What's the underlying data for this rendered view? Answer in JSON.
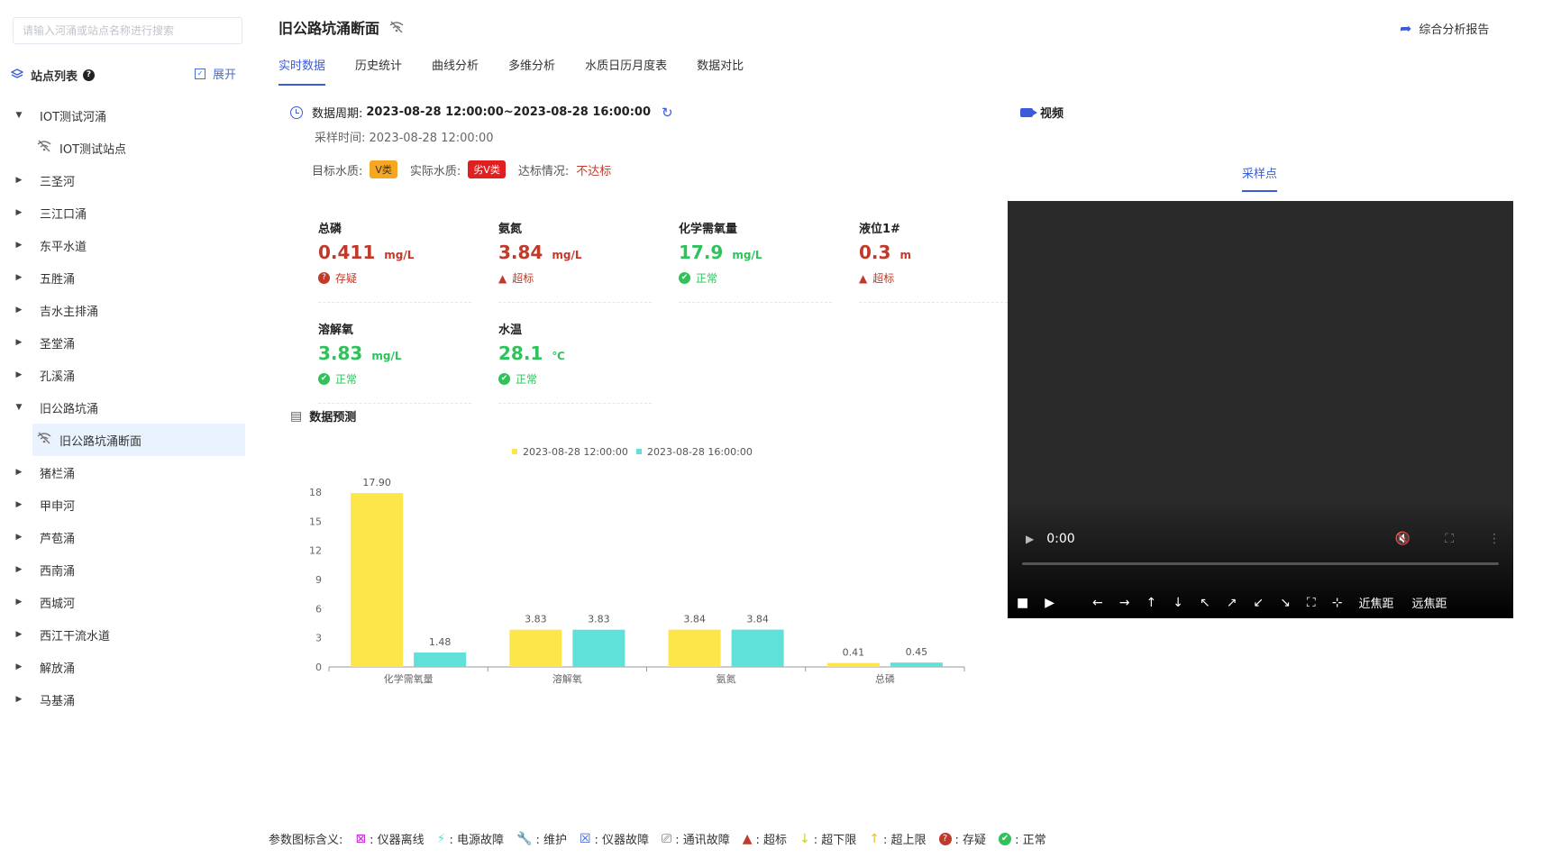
{
  "sidebar": {
    "search_placeholder": "请输入河涌或站点名称进行搜索",
    "title": "站点列表",
    "expand_label": "展开",
    "items": [
      {
        "label": "IOT测试河涌",
        "expanded": true,
        "children": [
          "IOT测试站点"
        ]
      },
      {
        "label": "三圣河"
      },
      {
        "label": "三江口涌"
      },
      {
        "label": "东平水道"
      },
      {
        "label": "五胜涌"
      },
      {
        "label": "吉水主排涌"
      },
      {
        "label": "圣堂涌"
      },
      {
        "label": "孔溪涌"
      },
      {
        "label": "旧公路坑涌",
        "expanded": true,
        "children": [
          "旧公路坑涌断面"
        ]
      },
      {
        "label": "猪栏涌"
      },
      {
        "label": "甲申河"
      },
      {
        "label": "芦苞涌"
      },
      {
        "label": "西南涌"
      },
      {
        "label": "西城河"
      },
      {
        "label": "西江干流水道"
      },
      {
        "label": "解放涌"
      },
      {
        "label": "马基涌"
      }
    ]
  },
  "header": {
    "title": "旧公路坑涌断面",
    "report_label": "综合分析报告",
    "tabs": [
      "实时数据",
      "历史统计",
      "曲线分析",
      "多维分析",
      "水质日历月度表",
      "数据对比"
    ]
  },
  "info": {
    "period_label": "数据周期:",
    "period_value": "2023-08-28 12:00:00~2023-08-28 16:00:00",
    "sample_time": "采样时间: 2023-08-28 12:00:00",
    "target_label": "目标水质:",
    "target_value": "V类",
    "actual_label": "实际水质:",
    "actual_value": "劣V类",
    "compliance_label": "达标情况:",
    "compliance_value": "不达标"
  },
  "metrics": [
    {
      "name": "总磷",
      "value": "0.411",
      "unit": "mg/L",
      "status": "存疑",
      "color": "red"
    },
    {
      "name": "氨氮",
      "value": "3.84",
      "unit": "mg/L",
      "status": "超标",
      "color": "red"
    },
    {
      "name": "化学需氧量",
      "value": "17.9",
      "unit": "mg/L",
      "status": "正常",
      "color": "green"
    },
    {
      "name": "液位1#",
      "value": "0.3",
      "unit": "m",
      "status": "超标",
      "color": "red"
    },
    {
      "name": "溶解氧",
      "value": "3.83",
      "unit": "mg/L",
      "status": "正常",
      "color": "green"
    },
    {
      "name": "水温",
      "value": "28.1",
      "unit": "℃",
      "status": "正常",
      "color": "green"
    }
  ],
  "predict": {
    "title": "数据预测"
  },
  "chart_data": {
    "type": "bar",
    "categories": [
      "化学需氧量",
      "溶解氧",
      "氨氮",
      "总磷"
    ],
    "series": [
      {
        "name": "2023-08-28 12:00:00",
        "values": [
          17.9,
          3.83,
          3.84,
          0.41
        ],
        "color": "#fce64a"
      },
      {
        "name": "2023-08-28 16:00:00",
        "values": [
          1.48,
          3.83,
          3.84,
          0.45
        ],
        "color": "#5fe0d8"
      }
    ],
    "data_labels": [
      [
        "17.90",
        "3.83",
        "3.84",
        "0.41"
      ],
      [
        "1.48",
        "3.83",
        "3.84",
        "0.45"
      ]
    ],
    "yticks": [
      "0",
      "3",
      "6",
      "9",
      "12",
      "15",
      "18"
    ],
    "ylim": [
      0,
      18
    ],
    "legend_position": "top"
  },
  "video": {
    "label": "视频",
    "tab": "采样点",
    "time": "0:00",
    "near_label": "近焦距",
    "far_label": "远焦距"
  },
  "legend": {
    "title": "参数图标含义:",
    "items": [
      {
        "icon": "instrument-offline-icon",
        "label": ": 仪器离线",
        "color": "#c026d3"
      },
      {
        "icon": "power-fault-icon",
        "label": ": 电源故障",
        "color": "#5fe0d8"
      },
      {
        "icon": "maintenance-icon",
        "label": ": 维护",
        "color": "#2fc25b"
      },
      {
        "icon": "instrument-fault-icon",
        "label": ": 仪器故障",
        "color": "#3b5bdb"
      },
      {
        "icon": "communication-fault-icon",
        "label": ": 通讯故障",
        "color": "#555555"
      },
      {
        "icon": "exceed-icon",
        "label": ": 超标",
        "color": "#c0392b"
      },
      {
        "icon": "below-lower-limit-icon",
        "label": ": 超下限",
        "color": "#c9d11f"
      },
      {
        "icon": "above-upper-limit-icon",
        "label": ": 超上限",
        "color": "#e6c229"
      },
      {
        "icon": "doubtful-icon",
        "label": ": 存疑",
        "color": "#c0392b"
      },
      {
        "icon": "normal-icon",
        "label": ": 正常",
        "color": "#2fc25b"
      }
    ]
  }
}
